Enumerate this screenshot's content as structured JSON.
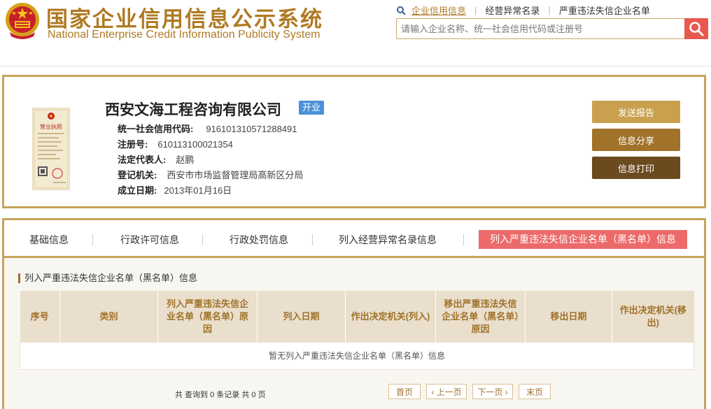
{
  "header": {
    "title_cn": "国家企业信用信息公示系统",
    "title_en": "National Enterprise Credit Information Publicity System",
    "nav": [
      {
        "label": "企业信用信息"
      },
      {
        "label": "经营异常名录"
      },
      {
        "label": "严重违法失信企业名单"
      }
    ],
    "search_placeholder": "请输入企业名称、统一社会信用代码或注册号"
  },
  "company": {
    "name": "西安文海工程咨询有限公司",
    "status": "开业",
    "fields": [
      {
        "label": "统一社会信用代码:",
        "value": "916101310571288491"
      },
      {
        "label": "注册号:",
        "value": "610113100021354"
      },
      {
        "label": "法定代表人:",
        "value": "赵鹏"
      },
      {
        "label": "登记机关:",
        "value": "西安市市场监督管理局高新区分局"
      },
      {
        "label": "成立日期:",
        "value": "2013年01月16日"
      }
    ],
    "license_title": "营业执照",
    "buttons": {
      "report": "发送报告",
      "share": "信息分享",
      "print": "信息打印"
    }
  },
  "tabs": [
    {
      "label": "基础信息"
    },
    {
      "label": "行政许可信息"
    },
    {
      "label": "行政处罚信息"
    },
    {
      "label": "列入经营异常名录信息"
    },
    {
      "label": "列入严重违法失信企业名单（黑名单）信息"
    }
  ],
  "section": {
    "title": "列入严重违法失信企业名单（黑名单）信息",
    "columns": [
      "序号",
      "类别",
      "列入严重违法失信企业名单（黑名单）原因",
      "列入日期",
      "作出决定机关(列入)",
      "移出严重违法失信企业名单（黑名单）原因",
      "移出日期",
      "作出决定机关(移出)"
    ],
    "empty_text": "暂无列入严重违法失信企业名单（黑名单）信息"
  },
  "pager": {
    "info": "共 查询到 0 条记录 共 0 页",
    "first": "首页",
    "prev": "‹ 上一页",
    "next": "下一页 ›",
    "last": "末页"
  },
  "colors": {
    "brand_gold": "#b07a22",
    "border_gold": "#c8a35a",
    "active_tab": "#ec6a6a",
    "status_blue": "#4a90d9",
    "search_red": "#e8584f"
  },
  "icons": {
    "emblem": "national-emblem-icon",
    "search": "magnifier-icon",
    "license": "business-license-icon"
  }
}
